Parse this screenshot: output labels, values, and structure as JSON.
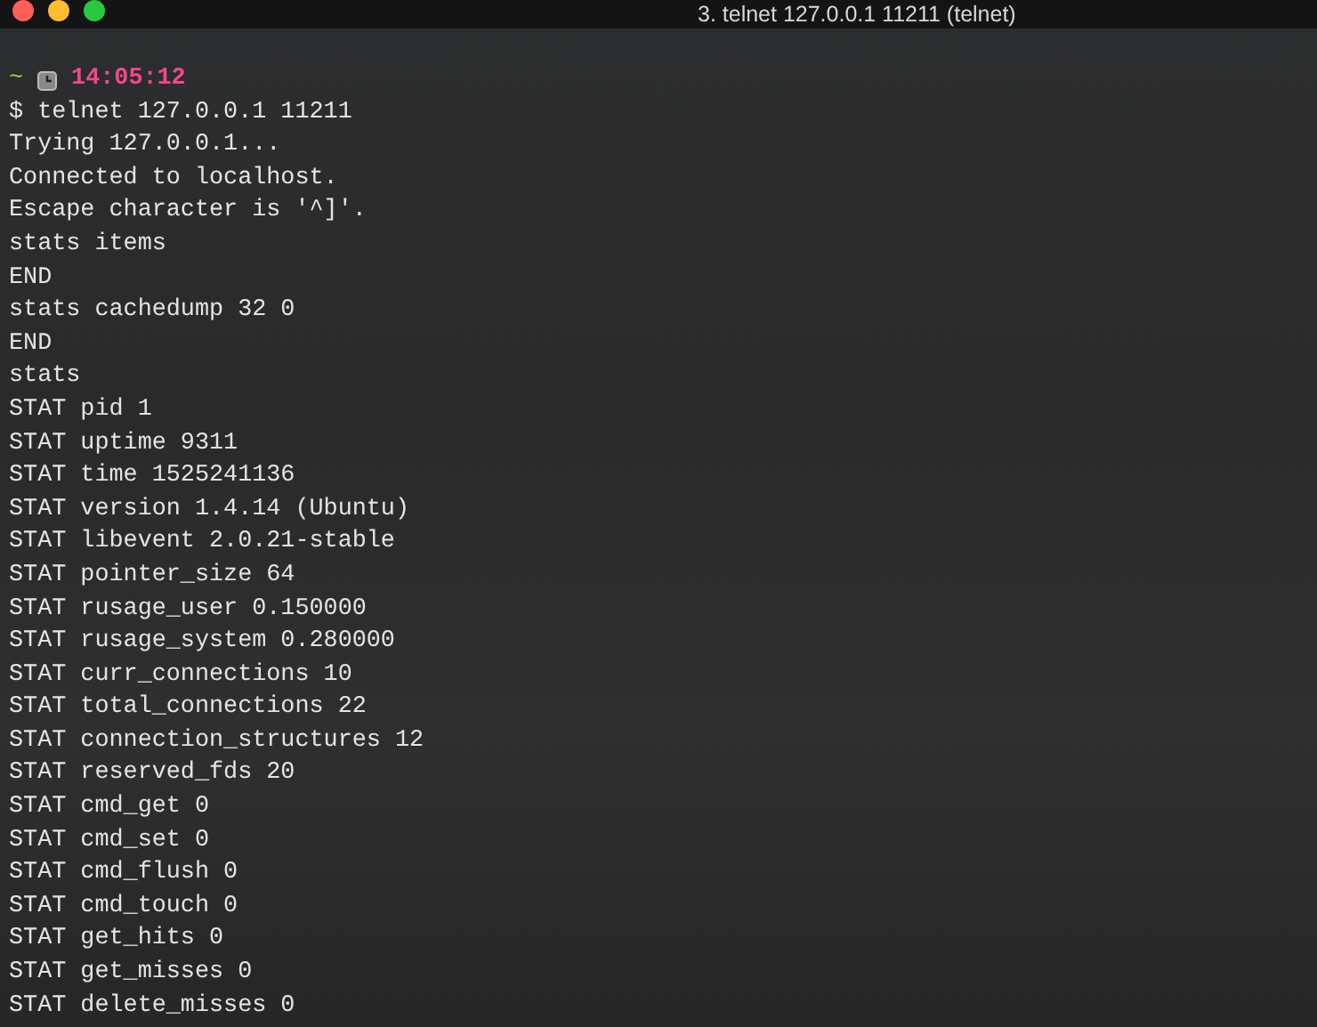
{
  "window": {
    "title": "3. telnet 127.0.0.1 11211 (telnet)"
  },
  "prompt": {
    "cwd": "~",
    "time": "14:05:12"
  },
  "lines": [
    "$ telnet 127.0.0.1 11211",
    "Trying 127.0.0.1...",
    "Connected to localhost.",
    "Escape character is '^]'.",
    "stats items",
    "END",
    "stats cachedump 32 0",
    "END",
    "stats",
    "STAT pid 1",
    "STAT uptime 9311",
    "STAT time 1525241136",
    "STAT version 1.4.14 (Ubuntu)",
    "STAT libevent 2.0.21-stable",
    "STAT pointer_size 64",
    "STAT rusage_user 0.150000",
    "STAT rusage_system 0.280000",
    "STAT curr_connections 10",
    "STAT total_connections 22",
    "STAT connection_structures 12",
    "STAT reserved_fds 20",
    "STAT cmd_get 0",
    "STAT cmd_set 0",
    "STAT cmd_flush 0",
    "STAT cmd_touch 0",
    "STAT get_hits 0",
    "STAT get_misses 0",
    "STAT delete_misses 0"
  ]
}
